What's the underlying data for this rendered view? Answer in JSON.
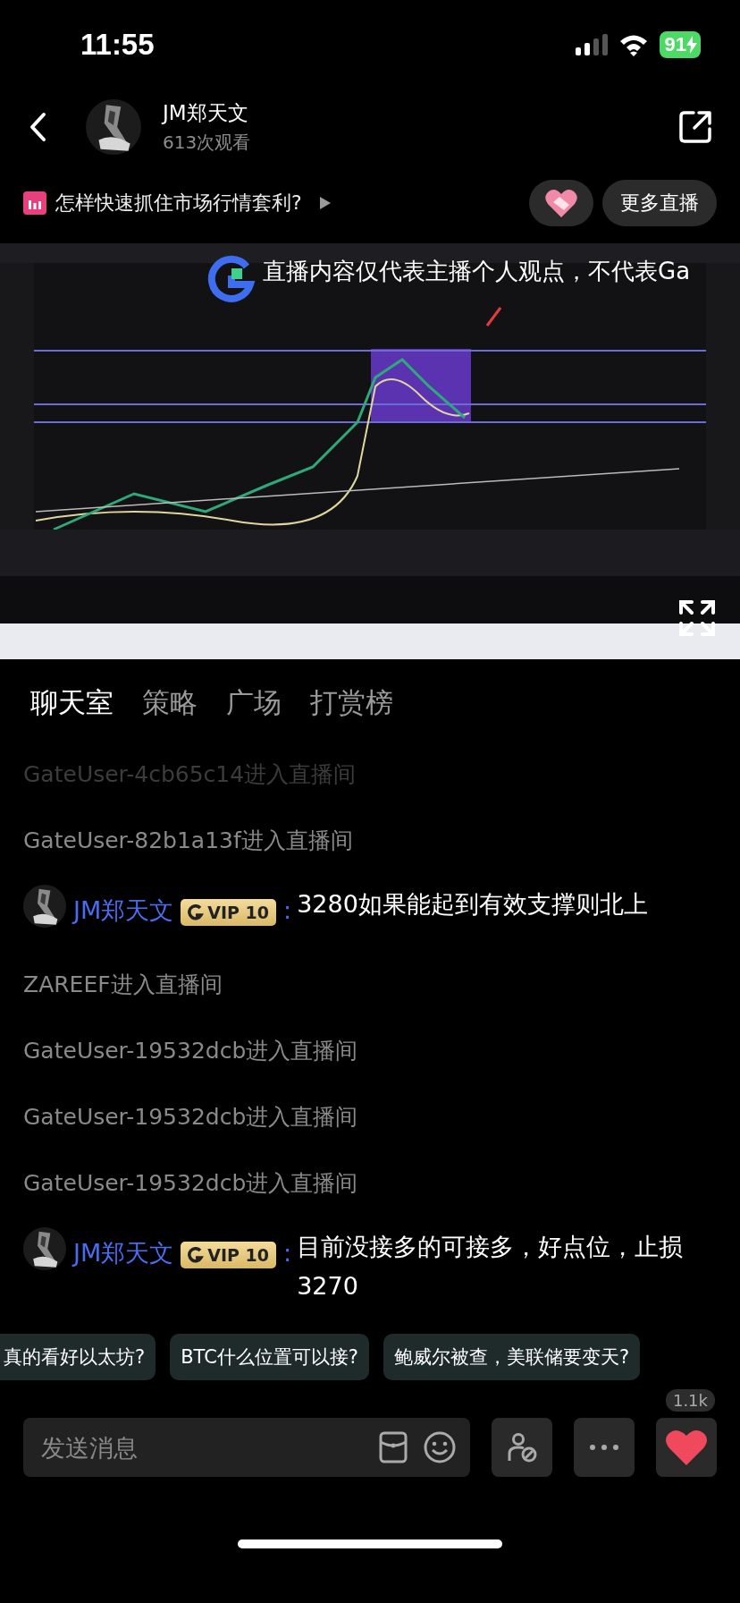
{
  "status_bar": {
    "time": "11:55",
    "battery": "91"
  },
  "header": {
    "name": "JM郑天文",
    "views": "613次观看"
  },
  "topic": {
    "title": "怎样快速抓住市场行情套利?",
    "more_live": "更多直播"
  },
  "video": {
    "kind": "picture",
    "notice": "直播内容仅代表主播个人观点，不代表Ga"
  },
  "tabs": [
    {
      "label": "聊天室",
      "selected": true
    },
    {
      "label": "策略",
      "selected": false
    },
    {
      "label": "广场",
      "selected": false
    },
    {
      "label": "打赏榜",
      "selected": false
    }
  ],
  "messages": [
    {
      "kind": "join",
      "text": "GateUser-4cb65c14进入直播间",
      "faded": true
    },
    {
      "kind": "join",
      "text": "GateUser-82b1a13f进入直播间",
      "faded": false
    },
    {
      "kind": "chat",
      "user": "JM郑天文",
      "badge": "VIP 10",
      "separator": ":",
      "text": "3280如果能起到有效支撑则北上"
    },
    {
      "kind": "join",
      "text": "ZAREEF进入直播间",
      "faded": false
    },
    {
      "kind": "join",
      "text": "GateUser-19532dcb进入直播间",
      "faded": false
    },
    {
      "kind": "join",
      "text": "GateUser-19532dcb进入直播间",
      "faded": false
    },
    {
      "kind": "join",
      "text": "GateUser-19532dcb进入直播间",
      "faded": false
    },
    {
      "kind": "chat",
      "user": "JM郑天文",
      "badge": "VIP 10",
      "separator": ":",
      "text": "目前没接多的可接多，好点位，止损3270"
    }
  ],
  "quick_questions": [
    "真的看好以太坊?",
    "BTC什么位置可以接?",
    "鲍威尔被查，美联储要变天?"
  ],
  "composer": {
    "placeholder": "发送消息",
    "like_count": "1.1k"
  }
}
